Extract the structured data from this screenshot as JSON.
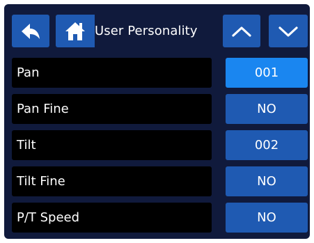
{
  "header": {
    "title": "User Personality",
    "icons": {
      "back": "back-arrow-icon",
      "home": "home-icon",
      "up": "chevron-up-icon",
      "down": "chevron-down-icon"
    }
  },
  "rows": [
    {
      "label": "Pan",
      "value": "001",
      "selected": true
    },
    {
      "label": "Pan Fine",
      "value": "NO",
      "selected": false
    },
    {
      "label": "Tilt",
      "value": "002",
      "selected": false
    },
    {
      "label": "Tilt Fine",
      "value": "NO",
      "selected": false
    },
    {
      "label": "P/T Speed",
      "value": "NO",
      "selected": false
    }
  ],
  "colors": {
    "background": "#101a3c",
    "button": "#1f5ab2",
    "selected": "#1a86f0",
    "label_bg": "#000000",
    "text": "#ffffff"
  }
}
